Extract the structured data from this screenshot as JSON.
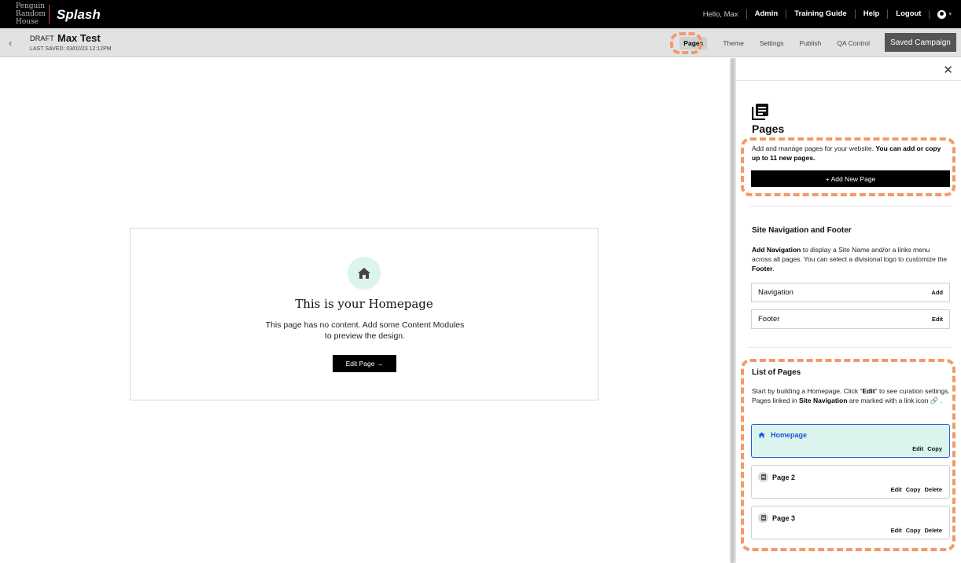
{
  "topbar": {
    "publisher_logo": [
      "Penguin",
      "Random",
      "House"
    ],
    "app_name": "Splash",
    "greeting": "Hello, Max",
    "links": [
      "Admin",
      "Training Guide",
      "Help",
      "Logout"
    ]
  },
  "subbar": {
    "status": "DRAFT",
    "campaign_name": "Max Test",
    "last_saved": "LAST SAVED: 03/02/23 12:12PM",
    "tabs": [
      "Pages",
      "Theme",
      "Settings",
      "Publish",
      "QA Control"
    ],
    "active_tab": "Pages",
    "save_button": "Saved Campaign"
  },
  "canvas": {
    "title": "This is your Homepage",
    "text": "This page has no content. Add some Content Modules to preview the design.",
    "edit_button": "Edit Page →"
  },
  "panel": {
    "title": "Pages",
    "pages_desc_plain": "Add and manage pages for your website. ",
    "pages_desc_bold": "You can add or copy up to 11 new pages.",
    "add_button": "+ Add New Page",
    "nav_section": {
      "title": "Site Navigation and Footer",
      "desc_b1": "Add Navigation",
      "desc_t1": " to display a Site Name and/or a links menu across all pages. You can select a divisional logo to customize the ",
      "desc_b2": "Footer",
      "desc_t2": ".",
      "rows": [
        {
          "label": "Navigation",
          "action": "Add"
        },
        {
          "label": "Footer",
          "action": "Edit"
        }
      ]
    },
    "list_section": {
      "title": "List of Pages",
      "desc_t1": "Start by building a Homepage. Click \"",
      "desc_b1": "Edit",
      "desc_t2": "\" to see curation settings. Pages linked in ",
      "desc_b2": "Site Navigation",
      "desc_t3": " are marked with a link icon ",
      "desc_t4": " .",
      "pages": [
        {
          "name": "Homepage",
          "actions": [
            "Edit",
            "Copy"
          ]
        },
        {
          "name": "Page 2",
          "actions": [
            "Edit",
            "Copy",
            "Delete"
          ]
        },
        {
          "name": "Page 3",
          "actions": [
            "Edit",
            "Copy",
            "Delete"
          ]
        }
      ]
    }
  },
  "colors": {
    "highlight": "#f29a6a",
    "active_page_bg": "#dcf4ee",
    "active_page_border": "#2b5be0",
    "home_icon_bg": "#dcf4ee"
  }
}
